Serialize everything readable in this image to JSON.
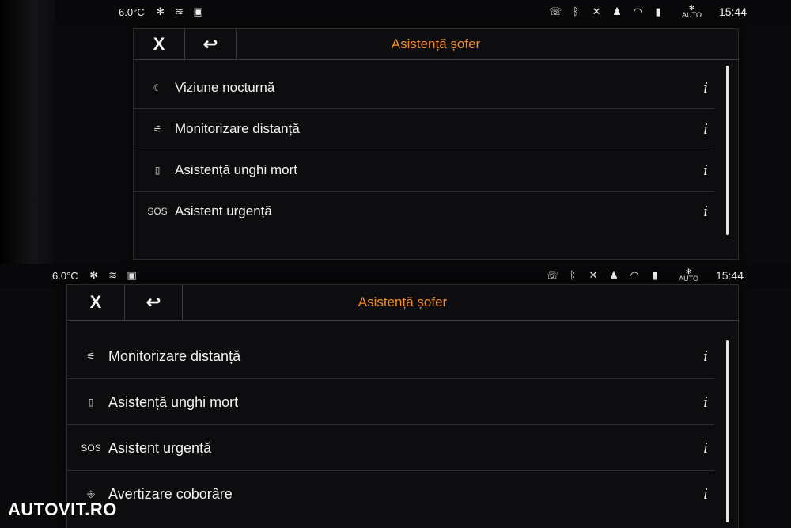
{
  "top": {
    "status": {
      "temperature": "6.0°C",
      "auto_label": "AUTO",
      "time": "15:44"
    },
    "back_icon": "↩",
    "close_label": "X",
    "title": "Asistență șofer",
    "items": [
      {
        "icon": "night-vision-icon",
        "glyph": "☾",
        "label": "Viziune nocturnă",
        "info": "i"
      },
      {
        "icon": "distance-monitor-icon",
        "glyph": "⚟",
        "label": "Monitorizare distanță",
        "info": "i"
      },
      {
        "icon": "blind-spot-icon",
        "glyph": "▯",
        "label": "Asistență unghi mort",
        "info": "i"
      },
      {
        "icon": "sos-icon",
        "glyph": "SOS",
        "label": "Asistent urgență",
        "info": "i"
      }
    ]
  },
  "bottom": {
    "status": {
      "temperature": "6.0°C",
      "auto_label": "AUTO",
      "time": "15:44"
    },
    "back_icon": "↩",
    "close_label": "X",
    "title": "Asistență șofer",
    "items": [
      {
        "icon": "distance-monitor-icon",
        "glyph": "⚟",
        "label": "Monitorizare distanță",
        "info": "i"
      },
      {
        "icon": "blind-spot-icon",
        "glyph": "▯",
        "label": "Asistență unghi mort",
        "info": "i"
      },
      {
        "icon": "sos-icon",
        "glyph": "SOS",
        "label": "Asistent urgență",
        "info": "i"
      },
      {
        "icon": "exit-warning-icon",
        "glyph": "⎆",
        "label": "Avertizare coborâre",
        "info": "i"
      }
    ]
  },
  "watermark": "AUTOVIT.RO"
}
